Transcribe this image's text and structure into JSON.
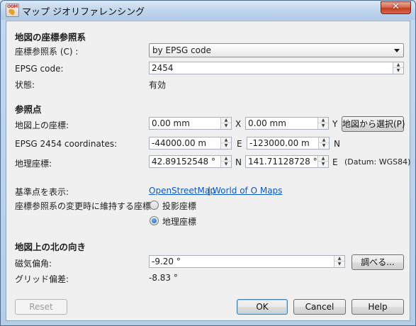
{
  "window": {
    "title": "マップ ジオリファレンシング",
    "app_icon_text": "OOM",
    "close_glyph": "✕"
  },
  "crs_section": {
    "heading": "地図の座標参照系",
    "crs_label": "座標参照系 (C) :",
    "crs_value": "by EPSG code",
    "epsg_label": "EPSG code:",
    "epsg_value": "2454",
    "status_label": "状態:",
    "status_value": "有効"
  },
  "ref_section": {
    "heading": "参照点",
    "map_coords_label": "地図上の座標:",
    "map_x": "0.00 mm",
    "map_x_unit": "X",
    "map_y": "0.00 mm",
    "map_y_unit": "Y",
    "pick_button": "地図から選択(P)",
    "epsg_coords_label": "EPSG 2454 coordinates:",
    "easting": "-44000.00 m",
    "easting_unit": "E",
    "northing": "-123000.00 m",
    "northing_unit": "N",
    "geo_coords_label": "地理座標:",
    "latitude": "42.89152548 °",
    "latitude_unit": "N",
    "longitude": "141.71128728 °",
    "longitude_unit": "E",
    "datum": "(Datum: WGS84)",
    "show_ref_label": "基準点を表示:",
    "link_osm": "OpenStreetMap",
    "link_separator": "|",
    "link_woo": "World of O Maps",
    "keep_on_change_label": "座標参照系の変更時に維持する座標:",
    "radio_projected": "投影座標",
    "radio_geographic": "地理座標",
    "selected_radio": "geographic"
  },
  "north_section": {
    "heading": "地図上の北の向き",
    "declination_label": "磁気偏角:",
    "declination_value": "-9.20 °",
    "lookup_button": "調べる...",
    "grid_label": "グリッド偏差:",
    "grid_value": "-8.83 °"
  },
  "buttons": {
    "reset": "Reset",
    "ok": "OK",
    "cancel": "Cancel",
    "help": "Help"
  },
  "spinner": {
    "up_glyph": "▲",
    "down_glyph": "▼"
  }
}
